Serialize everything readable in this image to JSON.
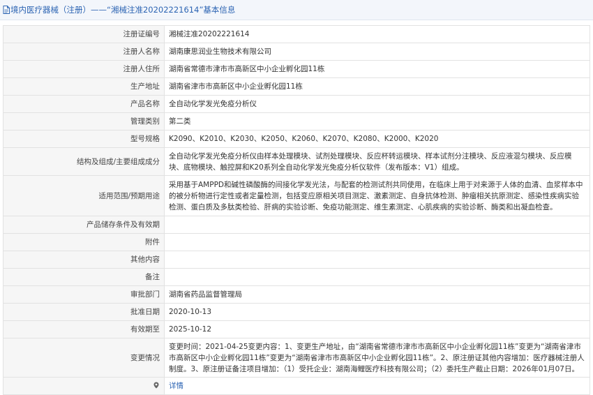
{
  "header": {
    "title": "境内医疗器械（注册）——“湘械注准20202221614”基本信息"
  },
  "rows": [
    {
      "label": "注册证编号",
      "value": "湘械注准20202221614"
    },
    {
      "label": "注册人名称",
      "value": "湖南康思润业生物技术有限公司"
    },
    {
      "label": "注册人住所",
      "value": "湖南省常德市津市市高新区中小企业孵化园11栋"
    },
    {
      "label": "生产地址",
      "value": "湖南省津市市高新区中小企业孵化园11栋"
    },
    {
      "label": "产品名称",
      "value": "全自动化学发光免疫分析仪"
    },
    {
      "label": "管理类别",
      "value": "第二类"
    },
    {
      "label": "型号规格",
      "value": "K2090、K2010、K2030、K2050、K2060、K2070、K2080、K2000、K2020"
    },
    {
      "label": "结构及组成/主要组成成分",
      "value": "全自动化学发光免疫分析仪由样本处理模块、试剂处理模块、反应杯转运模块、样本试剂分注模块、反应液混匀模块、反应模块、底物模块、触控屏和K20系列全自动化学发光免疫分析仪软件（发布版本：V1）组成。"
    },
    {
      "label": "适用范围/预期用途",
      "value": "采用基于AMPPD和碱性磷酸酶的间接化学发光法，与配套的检测试剂共同使用，在临床上用于对来源于人体的血清、血浆样本中的被分析物进行定性或者定量检测，包括变应原相关项目测定、激素测定、自身抗体检测、肿瘤相关抗原测定、感染性疾病实验检测、蛋白质及多肽类检验、肝病的实验诊断、免疫功能测定、维生素测定、心肌疾病的实验诊断、酶类和出凝血检查。"
    },
    {
      "label": "产品储存条件及有效期",
      "value": ""
    },
    {
      "label": "附件",
      "value": ""
    },
    {
      "label": "其他内容",
      "value": ""
    },
    {
      "label": "备注",
      "value": ""
    },
    {
      "label": "审批部门",
      "value": "湖南省药品监督管理局"
    },
    {
      "label": "批准日期",
      "value": "2020-10-13"
    },
    {
      "label": "有效期至",
      "value": "2025-10-12"
    },
    {
      "label": "变更情况",
      "value": "变更时间：2021-04-25变更内容：1、变更生产地址，由“湖南省常德市津市市高新区中小企业孵化园11栋”变更为“湖南省津市市高新区中小企业孵化园11栋”变更为“湖南省津市市高新区中小企业孵化园11栋”。2、原注册证其他内容增加：医疗器械注册人制度。3、原注册证备注项目增加：（1）受托企业：湖南海鲤医疗科技有限公司；（2）委托生产截止日期：2026年01月07日。"
    }
  ],
  "footer_row": {
    "label": "",
    "link": "详情"
  },
  "icons": {
    "title": "document-icon",
    "footer": "location-pin-icon"
  },
  "colors": {
    "accent": "#2c64b3",
    "label_bg": "#f6f6f6",
    "border": "#e2e2e2"
  }
}
